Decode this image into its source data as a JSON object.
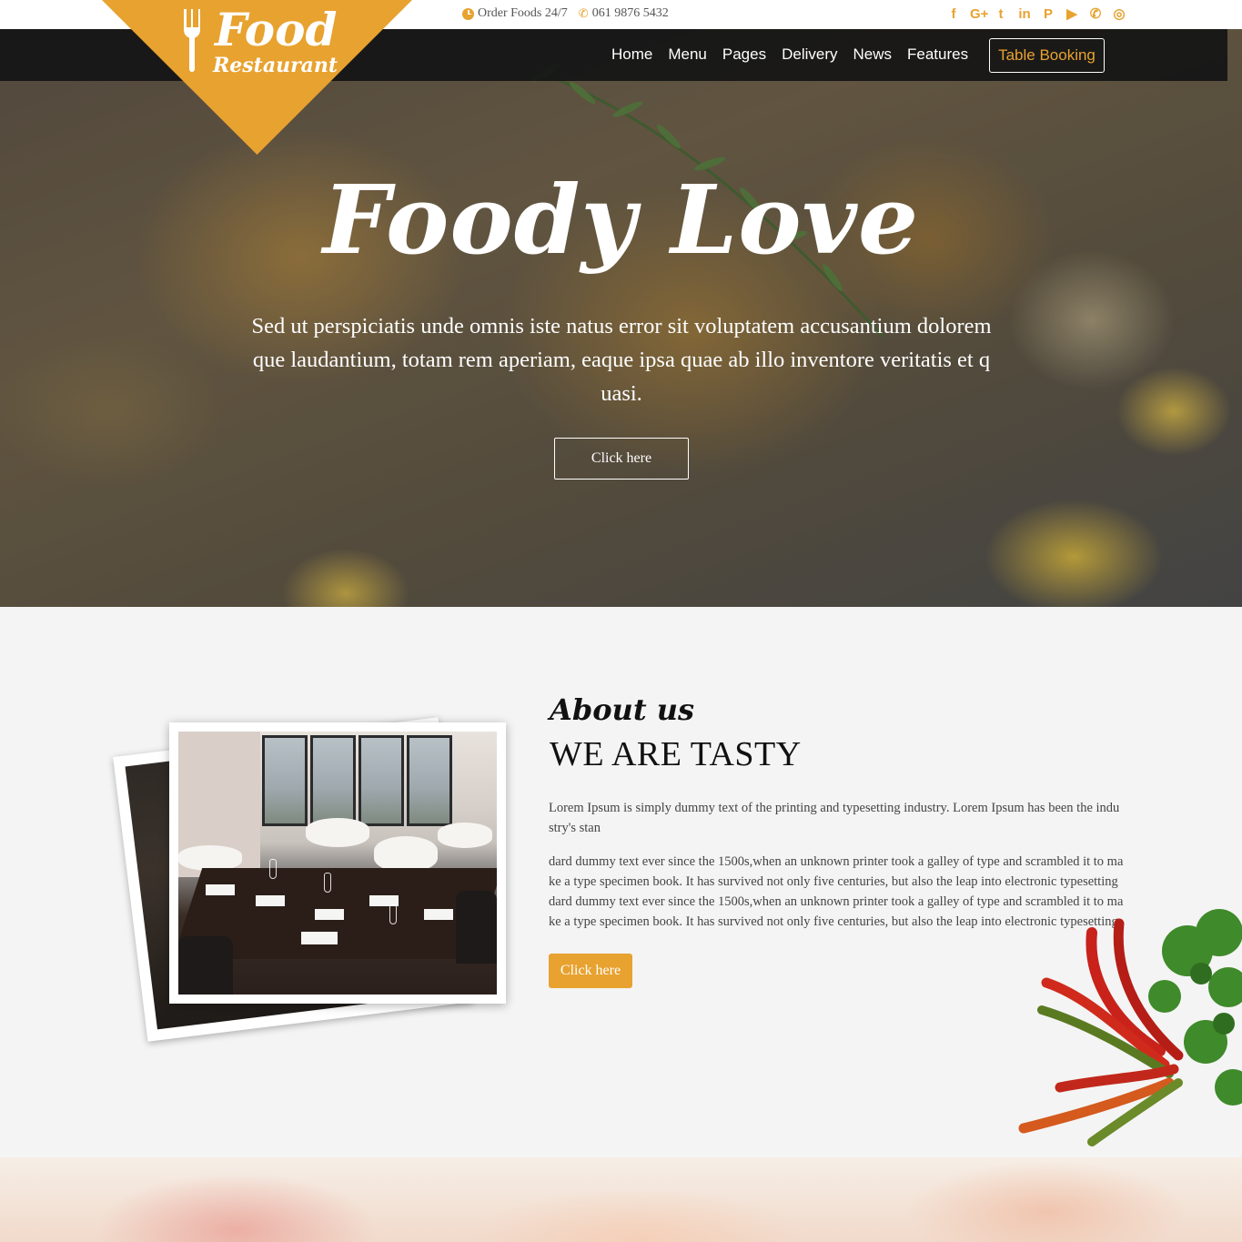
{
  "brand": {
    "name": "Food",
    "subtitle": "Restaurant"
  },
  "contact": {
    "hours": "Order Foods 24/7",
    "phone": "061 9876 5432"
  },
  "social": [
    {
      "name": "facebook-icon",
      "glyph": "f"
    },
    {
      "name": "google-plus-icon",
      "glyph": "G+"
    },
    {
      "name": "twitter-icon",
      "glyph": "t"
    },
    {
      "name": "linkedin-icon",
      "glyph": "in"
    },
    {
      "name": "pinterest-icon",
      "glyph": "P"
    },
    {
      "name": "youtube-icon",
      "glyph": "▶"
    },
    {
      "name": "whatsapp-icon",
      "glyph": "✆"
    },
    {
      "name": "instagram-icon",
      "glyph": "◎"
    }
  ],
  "nav": {
    "items": [
      "Home",
      "Menu",
      "Pages",
      "Delivery",
      "News",
      "Features"
    ],
    "booking": "Table Booking"
  },
  "hero": {
    "title": "Foody Love",
    "text": "Sed ut perspiciatis unde omnis iste natus error sit voluptatem accusantium dolorem que laudantium, totam rem aperiam, eaque ipsa quae ab illo inventore veritatis et q uasi.",
    "button": "Click here"
  },
  "about": {
    "script_title": "About us",
    "title": "WE ARE TASTY",
    "p1": "Lorem Ipsum is simply dummy text of the printing and typesetting industry. Lorem Ipsum has been the indu stry's stan",
    "p2": "dard dummy text ever since the 1500s,when an unknown printer took a galley of type and scrambled it to ma ke a type specimen book. It has survived not only five centuries, but also the leap into electronic typesetting dard dummy text ever since the 1500s,when an unknown printer took a galley of type and scrambled it to ma ke a type specimen book. It has survived not only five centuries, but also the leap into electronic typesetting",
    "button": "Click here"
  },
  "colors": {
    "accent": "#e8a22f",
    "nav_bg": "#141416",
    "section_bg": "#f4f4f4"
  }
}
